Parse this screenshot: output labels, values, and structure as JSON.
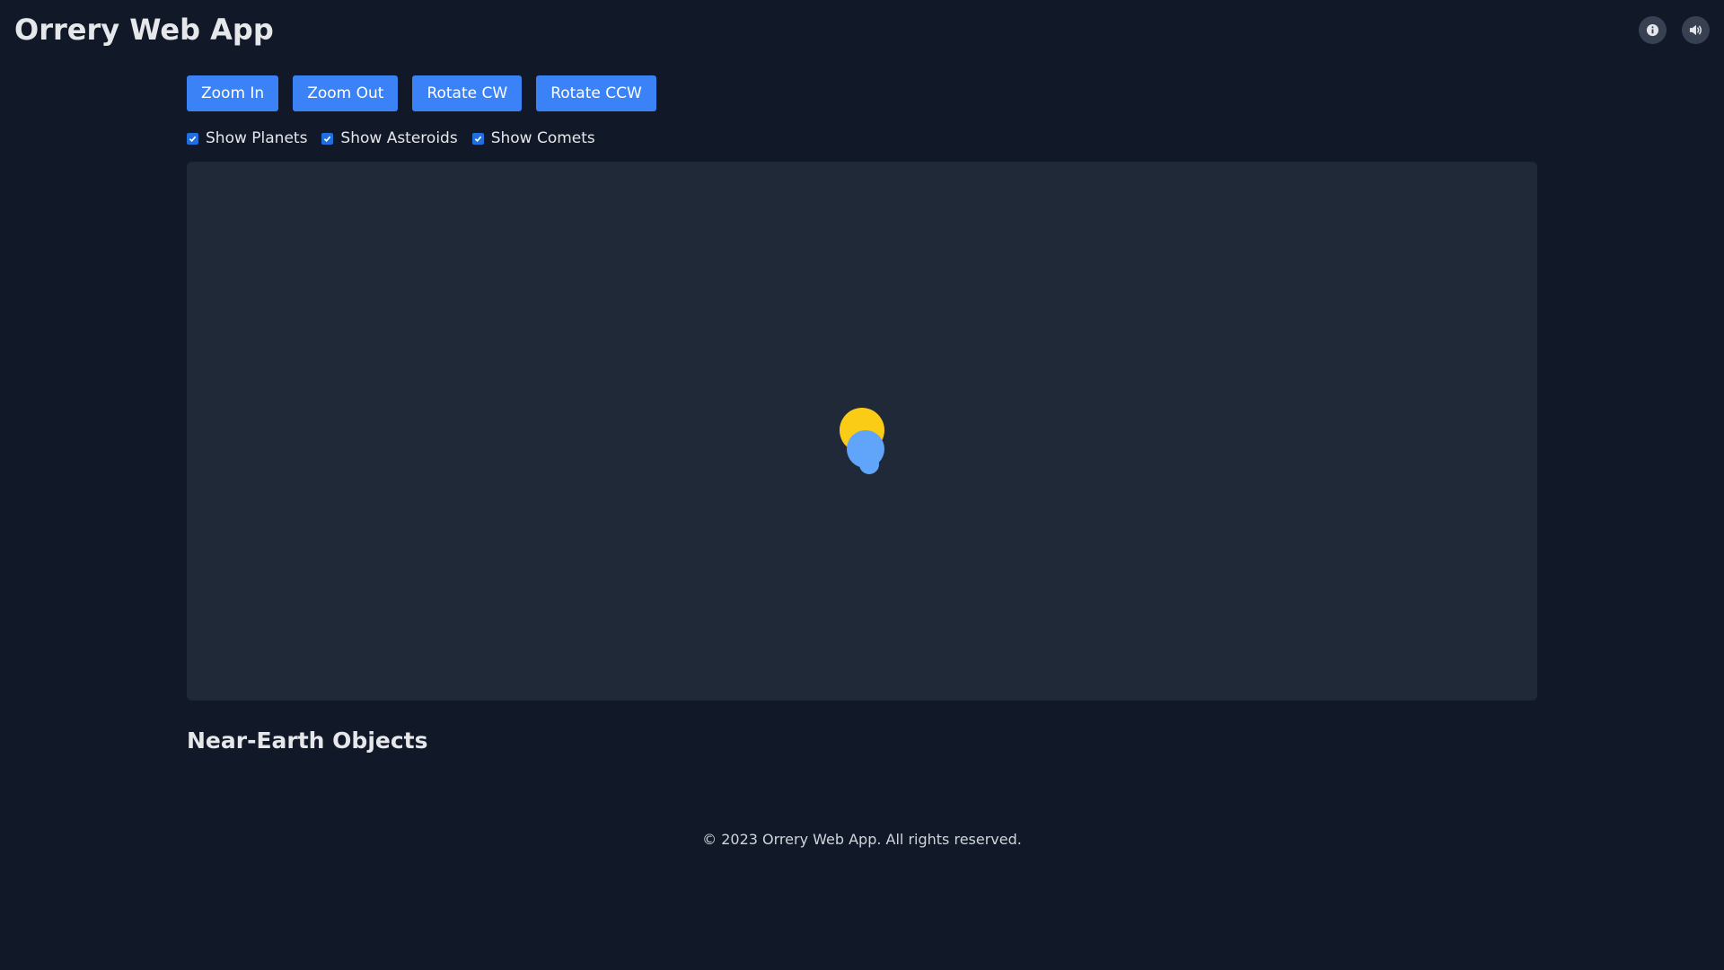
{
  "app": {
    "title": "Orrery Web App"
  },
  "header": {
    "info_icon": "info-icon",
    "sound_icon": "speaker-icon"
  },
  "controls": {
    "zoom_in": "Zoom In",
    "zoom_out": "Zoom Out",
    "rotate_cw": "Rotate CW",
    "rotate_ccw": "Rotate CCW"
  },
  "toggles": [
    {
      "label": "Show Planets",
      "checked": true
    },
    {
      "label": "Show Asteroids",
      "checked": true
    },
    {
      "label": "Show Comets",
      "checked": true
    }
  ],
  "orrery": {
    "sun_color": "#facc15",
    "planet_color": "#60a5fa",
    "background_color": "#1f2937"
  },
  "sections": {
    "neo_heading": "Near-Earth Objects"
  },
  "footer": {
    "copyright": "© 2023 Orrery Web App. All rights reserved."
  }
}
